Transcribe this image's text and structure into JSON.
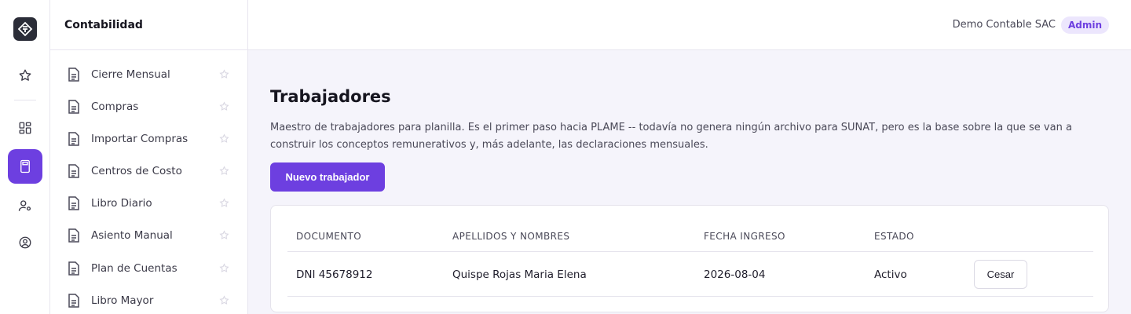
{
  "header": {
    "company": "Demo Contable SAC",
    "role": "Admin"
  },
  "sidebar": {
    "section_title": "Contabilidad",
    "items": [
      {
        "label": "Cierre Mensual"
      },
      {
        "label": "Compras"
      },
      {
        "label": "Importar Compras"
      },
      {
        "label": "Centros de Costo"
      },
      {
        "label": "Libro Diario"
      },
      {
        "label": "Asiento Manual"
      },
      {
        "label": "Plan de Cuentas"
      },
      {
        "label": "Libro Mayor"
      }
    ]
  },
  "rail": {
    "icons": [
      "logo-icon",
      "star-icon",
      "dashboard-icon",
      "calculator-icon",
      "user-settings-icon",
      "user-circle-icon"
    ],
    "active": "calculator-icon"
  },
  "main": {
    "title": "Trabajadores",
    "description": "Maestro de trabajadores para planilla. Es el primer paso hacia PLAME -- todavía no genera ningún archivo para SUNAT, pero es la base sobre la que se van a construir los conceptos remunerativos y, más adelante, las declaraciones mensuales.",
    "new_button": "Nuevo trabajador",
    "table": {
      "columns": [
        "DOCUMENTO",
        "APELLIDOS Y NOMBRES",
        "FECHA INGRESO",
        "ESTADO"
      ],
      "rows": [
        {
          "documento": "DNI 45678912",
          "nombre": "Quispe Rojas Maria Elena",
          "fecha": "2026-08-04",
          "estado": "Activo",
          "action": "Cesar"
        }
      ]
    }
  },
  "colors": {
    "accent": "#6d3fe0",
    "badge_bg": "#ece6fd",
    "page_bg": "#f5f4fb"
  }
}
